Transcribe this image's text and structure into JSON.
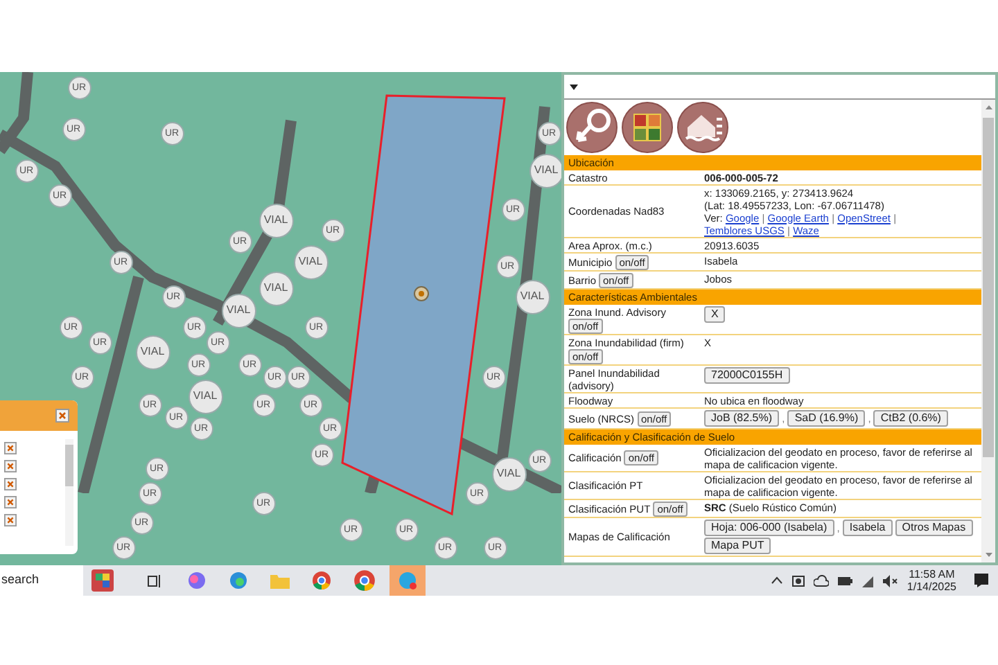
{
  "map": {
    "markers": [
      {
        "label": "UR"
      },
      {
        "label": "UR"
      },
      {
        "label": "UR"
      },
      {
        "label": "UR"
      },
      {
        "label": "UR"
      },
      {
        "label": "VIAL"
      },
      {
        "label": "UR"
      },
      {
        "label": "UR"
      },
      {
        "label": "VIAL"
      },
      {
        "label": "UR"
      },
      {
        "label": "UR"
      },
      {
        "label": "UR"
      },
      {
        "label": "VIAL"
      },
      {
        "label": "UR"
      },
      {
        "label": "VIAL"
      },
      {
        "label": "UR"
      },
      {
        "label": "VIAL"
      },
      {
        "label": "VIAL"
      },
      {
        "label": "UR"
      },
      {
        "label": "UR"
      },
      {
        "label": "UR"
      },
      {
        "label": "UR"
      },
      {
        "label": "UR"
      },
      {
        "label": "VIAL"
      },
      {
        "label": "UR"
      },
      {
        "label": "UR"
      },
      {
        "label": "UR"
      },
      {
        "label": "UR"
      },
      {
        "label": "UR"
      },
      {
        "label": "UR"
      },
      {
        "label": "VIAL"
      },
      {
        "label": "UR"
      },
      {
        "label": "UR"
      },
      {
        "label": "UR"
      },
      {
        "label": "UR"
      },
      {
        "label": "UR"
      },
      {
        "label": "UR"
      },
      {
        "label": "UR"
      },
      {
        "label": "UR"
      },
      {
        "label": "UR"
      },
      {
        "label": "VIAL"
      },
      {
        "label": "UR"
      },
      {
        "label": "UR"
      },
      {
        "label": "UR"
      },
      {
        "label": "UR"
      },
      {
        "label": "UR"
      },
      {
        "label": "UR"
      },
      {
        "label": "UR"
      },
      {
        "label": "UR"
      },
      {
        "label": "UR"
      }
    ]
  },
  "info_panel": {
    "sections": [
      {
        "title": "Ubicación",
        "rows": [
          {
            "label": "Catastro",
            "value": [
              {
                "kind": "bold",
                "text": "006-000-005-72"
              }
            ]
          },
          {
            "label": "Coordenadas Nad83",
            "value": [
              {
                "kind": "line",
                "text": "x: 133069.2165, y: 273413.9624"
              },
              {
                "kind": "line",
                "text": "(Lat: 18.49557233, Lon: -67.06711478)"
              },
              {
                "kind": "text",
                "text": "Ver:"
              },
              {
                "kind": "link",
                "text": "Google"
              },
              {
                "kind": "sep",
                "text": "|"
              },
              {
                "kind": "link",
                "text": "Google Earth"
              },
              {
                "kind": "sep",
                "text": "|"
              },
              {
                "kind": "link",
                "text": "OpenStreet"
              },
              {
                "kind": "sep",
                "text": "|"
              },
              {
                "kind": "link",
                "text": "Temblores USGS"
              },
              {
                "kind": "sep",
                "text": "|"
              },
              {
                "kind": "link",
                "text": "Waze"
              }
            ]
          },
          {
            "label": "Area Aprox. (m.c.)",
            "value": [
              {
                "kind": "line",
                "text": "20913.6035"
              }
            ]
          },
          {
            "label": "Municipio",
            "toggle": "on/off",
            "value": [
              {
                "kind": "line",
                "text": "Isabela"
              }
            ]
          },
          {
            "label": "Barrio",
            "toggle": "on/off",
            "value": [
              {
                "kind": "line",
                "text": "Jobos"
              }
            ]
          }
        ]
      },
      {
        "title": "Características Ambientales",
        "rows": [
          {
            "label": "Zona Inund. Advisory",
            "toggle": "on/off",
            "value": [
              {
                "kind": "button",
                "text": "X"
              }
            ]
          },
          {
            "label": "Zona Inundabilidad (firm)",
            "toggle": "on/off",
            "value": [
              {
                "kind": "line",
                "text": "X"
              }
            ]
          },
          {
            "label": "Panel Inundabilidad (advisory)",
            "value": [
              {
                "kind": "button",
                "text": "72000C0155H"
              }
            ]
          },
          {
            "label": "Floodway",
            "value": [
              {
                "kind": "line",
                "text": "No ubica en floodway"
              }
            ]
          },
          {
            "label": "Suelo (NRCS)",
            "toggle": "on/off",
            "value": [
              {
                "kind": "button",
                "text": "JoB (82.5%)"
              },
              {
                "kind": "sep",
                "text": ","
              },
              {
                "kind": "button",
                "text": "SaD (16.9%)"
              },
              {
                "kind": "sep",
                "text": ","
              },
              {
                "kind": "button",
                "text": "CtB2 (0.6%)"
              }
            ]
          }
        ]
      },
      {
        "title": "Calificación y Clasificación de Suelo",
        "rows": [
          {
            "label": "Calificación",
            "toggle": "on/off",
            "value": [
              {
                "kind": "line",
                "text": "Oficializacion del geodato en proceso, favor de referirse al mapa de calificacion vigente."
              }
            ]
          },
          {
            "label": "Clasificación PT",
            "value": [
              {
                "kind": "line",
                "text": "Oficializacion del geodato en proceso, favor de referirse al mapa de calificacion vigente."
              }
            ]
          },
          {
            "label": "Clasificación PUT",
            "toggle": "on/off",
            "value": [
              {
                "kind": "rich",
                "text": "**SRC** (Suelo Rústico Común)"
              }
            ]
          },
          {
            "label": "Mapas de Calificación",
            "value": [
              {
                "kind": "button",
                "text": "Hoja: 006-000 (Isabela)"
              },
              {
                "kind": "sep",
                "text": ","
              },
              {
                "kind": "button",
                "text": "Isabela"
              },
              {
                "kind": "button",
                "text": "Otros Mapas"
              },
              {
                "kind": "button",
                "text": "Mapa PUT"
              }
            ]
          }
        ]
      }
    ]
  },
  "taskbar": {
    "search": "search",
    "time": "11:58 AM",
    "date": "1/14/2025"
  }
}
